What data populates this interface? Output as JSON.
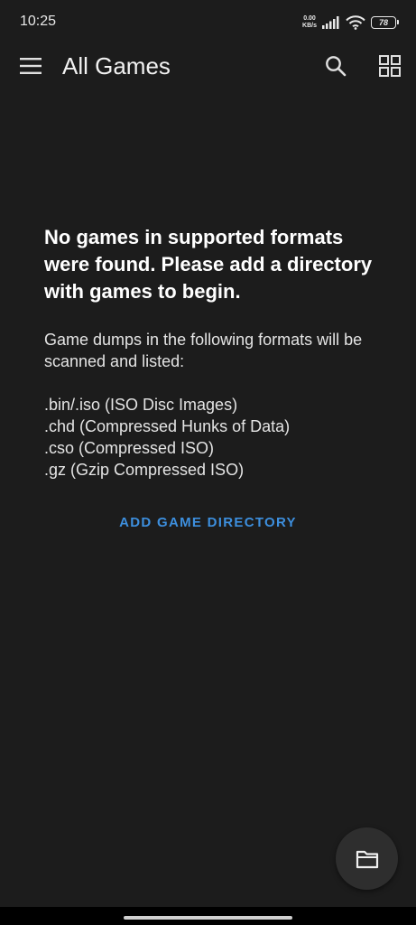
{
  "status_bar": {
    "time": "10:25",
    "net_speed_value": "0.00",
    "net_speed_unit": "KB/s",
    "battery_level": "78",
    "icons": [
      "signal-icon",
      "wifi-icon",
      "battery-icon"
    ]
  },
  "toolbar": {
    "title": "All Games",
    "icons": [
      "menu-icon",
      "search-icon",
      "grid-view-icon"
    ]
  },
  "empty_state": {
    "title": "No games in supported formats were found. Please add a directory with games to begin.",
    "description": "Game dumps in the following formats will be scanned and listed:",
    "formats": [
      ".bin/.iso (ISO Disc Images)",
      ".chd (Compressed Hunks of Data)",
      ".cso (Compressed ISO)",
      ".gz (Gzip Compressed ISO)"
    ],
    "add_button_label": "ADD GAME DIRECTORY"
  },
  "fab": {
    "icon": "folder-icon"
  },
  "colors": {
    "background": "#1c1c1c",
    "accent": "#3d8fde",
    "fab_background": "#2e2e2e"
  }
}
